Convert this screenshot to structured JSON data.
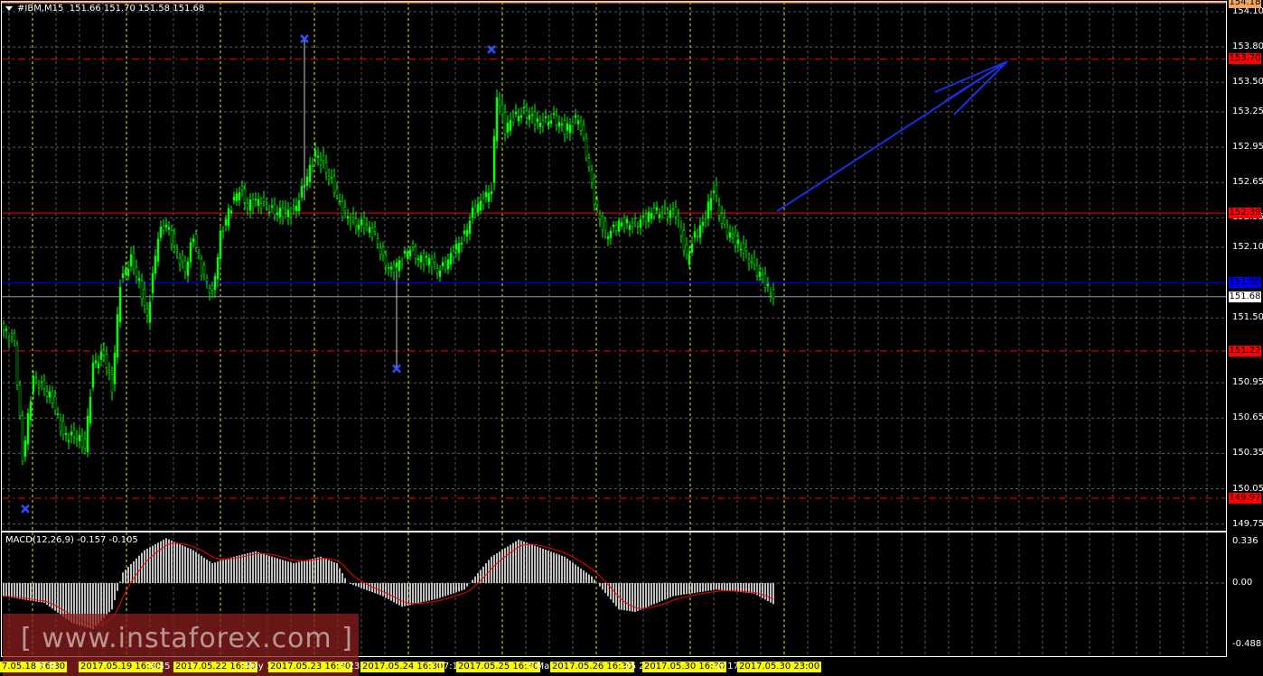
{
  "header": {
    "symbol": "#IBM,M15",
    "ohlc": "151.66 151.70 151.58 151.68"
  },
  "macd": {
    "label": "MACD(12,26,9) -0.157 -0.105"
  },
  "watermark": "[ www.instaforex.com ]",
  "colors": {
    "bull": "#00ff00",
    "grid": "#8a9aa8",
    "day_grid": "#ffff00",
    "resistance": "#ff0000",
    "support": "#0000ff",
    "histogram": "#c0c0c0",
    "signal": "#ff0000",
    "marker": "#3050ff",
    "arrow": "#1a2fe0"
  },
  "chart_data": {
    "type": "candlestick",
    "price_axis": {
      "ylim": [
        149.75,
        154.1
      ],
      "ticks": [
        "154.10",
        "153.80",
        "153.50",
        "153.25",
        "152.95",
        "152.65",
        "152.35",
        "152.10",
        "151.50",
        "150.95",
        "150.65",
        "150.35",
        "150.05",
        "149.75"
      ]
    },
    "price_tags": [
      {
        "value": "154.18",
        "kind": "top",
        "color": "#f4a460",
        "text": "#000"
      },
      {
        "value": "153.70",
        "kind": "dashed-red",
        "color": "#ff0000",
        "text": "#000"
      },
      {
        "value": "152.39",
        "kind": "solid-red",
        "color": "#ff0000",
        "text": "#000"
      },
      {
        "value": "151.80",
        "kind": "solid-blue",
        "color": "#0000ff",
        "text": "#000"
      },
      {
        "value": "151.68",
        "kind": "bid",
        "color": "#ffffff",
        "text": "#000"
      },
      {
        "value": "151.22",
        "kind": "dashed-red",
        "color": "#ff0000",
        "text": "#000"
      },
      {
        "value": "149.97",
        "kind": "dashed-red",
        "color": "#ff0000",
        "text": "#000"
      }
    ],
    "bars": 285,
    "close_keypoints": [
      [
        0,
        151.4
      ],
      [
        4,
        151.3
      ],
      [
        7,
        150.3
      ],
      [
        11,
        151.0
      ],
      [
        15,
        150.9
      ],
      [
        18,
        150.8
      ],
      [
        22,
        150.5
      ],
      [
        27,
        150.5
      ],
      [
        30,
        150.4
      ],
      [
        33,
        151.1
      ],
      [
        37,
        151.2
      ],
      [
        40,
        150.9
      ],
      [
        43,
        151.8
      ],
      [
        47,
        152.0
      ],
      [
        50,
        151.8
      ],
      [
        53,
        151.5
      ],
      [
        57,
        152.2
      ],
      [
        60,
        152.3
      ],
      [
        63,
        152.1
      ],
      [
        67,
        151.9
      ],
      [
        70,
        152.2
      ],
      [
        73,
        151.9
      ],
      [
        77,
        151.7
      ],
      [
        80,
        152.2
      ],
      [
        83,
        152.4
      ],
      [
        87,
        152.6
      ],
      [
        90,
        152.45
      ],
      [
        93,
        152.5
      ],
      [
        100,
        152.4
      ],
      [
        107,
        152.4
      ],
      [
        112,
        152.7
      ],
      [
        115,
        152.9
      ],
      [
        118,
        152.8
      ],
      [
        122,
        152.6
      ],
      [
        125,
        152.4
      ],
      [
        130,
        152.3
      ],
      [
        133,
        152.3
      ],
      [
        137,
        152.2
      ],
      [
        140,
        152.0
      ],
      [
        143,
        151.9
      ],
      [
        147,
        152.0
      ],
      [
        150,
        152.1
      ],
      [
        153,
        152.0
      ],
      [
        157,
        152.0
      ],
      [
        160,
        151.9
      ],
      [
        163,
        151.95
      ],
      [
        167,
        152.1
      ],
      [
        170,
        152.2
      ],
      [
        173,
        152.4
      ],
      [
        177,
        152.5
      ],
      [
        180,
        152.6
      ],
      [
        182,
        153.4
      ],
      [
        185,
        153.1
      ],
      [
        188,
        153.2
      ],
      [
        192,
        153.25
      ],
      [
        195,
        153.2
      ],
      [
        198,
        153.15
      ],
      [
        203,
        153.2
      ],
      [
        207,
        153.1
      ],
      [
        212,
        153.2
      ],
      [
        215,
        152.9
      ],
      [
        218,
        152.5
      ],
      [
        222,
        152.2
      ],
      [
        227,
        152.3
      ],
      [
        233,
        152.3
      ],
      [
        240,
        152.4
      ],
      [
        248,
        152.4
      ],
      [
        252,
        152.0
      ],
      [
        255,
        152.2
      ],
      [
        258,
        152.3
      ],
      [
        262,
        152.6
      ],
      [
        265,
        152.3
      ],
      [
        268,
        152.2
      ],
      [
        272,
        152.1
      ],
      [
        275,
        152.0
      ],
      [
        278,
        151.9
      ],
      [
        282,
        151.75
      ],
      [
        284,
        151.68
      ]
    ],
    "macd_axis": {
      "ylim": [
        -0.488,
        0.336
      ],
      "ticks": [
        "0.336",
        "0.00",
        "-0.488"
      ]
    },
    "macd_keypoints": [
      [
        0,
        -0.1
      ],
      [
        15,
        -0.15
      ],
      [
        25,
        -0.3
      ],
      [
        33,
        -0.35
      ],
      [
        40,
        -0.2
      ],
      [
        44,
        0.08
      ],
      [
        52,
        0.25
      ],
      [
        60,
        0.34
      ],
      [
        70,
        0.25
      ],
      [
        77,
        0.15
      ],
      [
        85,
        0.2
      ],
      [
        93,
        0.24
      ],
      [
        107,
        0.15
      ],
      [
        117,
        0.2
      ],
      [
        123,
        0.15
      ],
      [
        127,
        0.0
      ],
      [
        140,
        -0.1
      ],
      [
        147,
        -0.18
      ],
      [
        160,
        -0.12
      ],
      [
        170,
        -0.05
      ],
      [
        180,
        0.2
      ],
      [
        190,
        0.33
      ],
      [
        207,
        0.2
      ],
      [
        217,
        0.05
      ],
      [
        227,
        -0.2
      ],
      [
        233,
        -0.22
      ],
      [
        247,
        -0.1
      ],
      [
        263,
        -0.05
      ],
      [
        277,
        -0.08
      ],
      [
        284,
        -0.16
      ]
    ],
    "markers": [
      {
        "bar": 111,
        "price": 153.87
      },
      {
        "bar": 180,
        "price": 153.78
      },
      {
        "bar": 145,
        "price": 151.07
      },
      {
        "bar": 8,
        "price": 149.88
      }
    ],
    "time_labels": [
      {
        "text": "7.05.18 16:30",
        "hl": true,
        "at": 0
      },
      {
        "text": "18 M",
        "hl": false,
        "at": 38
      },
      {
        "text": "2017.05.19 16:30",
        "hl": true,
        "at": 87
      },
      {
        "text": "6:45",
        "hl": false,
        "at": 166
      },
      {
        "text": "2017.05.22 16:30",
        "hl": true,
        "at": 192
      },
      {
        "text": "May 1",
        "hl": false,
        "at": 271
      },
      {
        "text": "2017.05.23 16:30",
        "hl": true,
        "at": 297
      },
      {
        "text": "5 23",
        "hl": false,
        "at": 376
      },
      {
        "text": "2017.05.24 16:30",
        "hl": true,
        "at": 399
      },
      {
        "text": "/ 17:1",
        "hl": false,
        "at": 478
      },
      {
        "text": "2017.05.25 16:30",
        "hl": true,
        "at": 505
      },
      {
        "text": "5 May",
        "hl": false,
        "at": 584
      },
      {
        "text": "2017.05.26 16:30",
        "hl": true,
        "at": 609
      },
      {
        "text": ":45 2",
        "hl": false,
        "at": 688
      },
      {
        "text": "2017.05.30 16:30",
        "hl": true,
        "at": 711
      },
      {
        "text": "ay 17",
        "hl": false,
        "at": 790
      },
      {
        "text": "2017.05.30 23:00",
        "hl": true,
        "at": 816
      }
    ]
  }
}
